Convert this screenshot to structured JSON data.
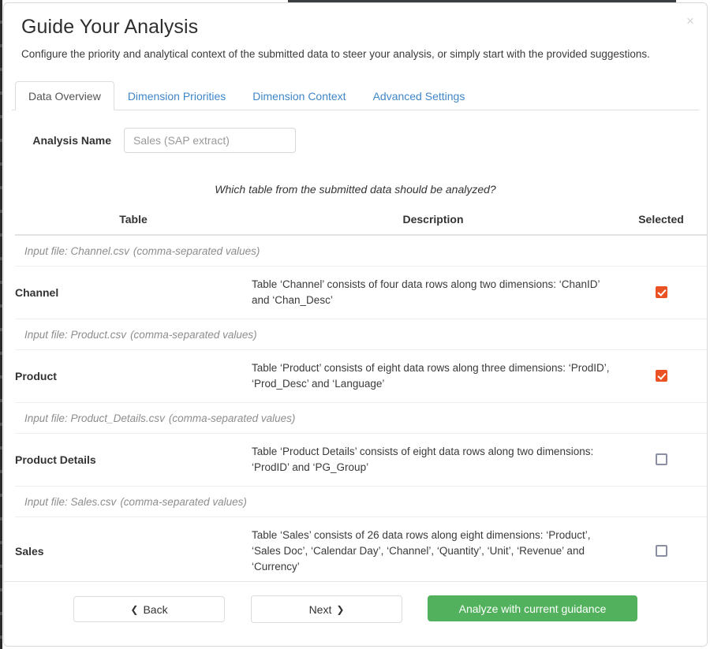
{
  "dialog": {
    "title": "Guide Your Analysis",
    "subtitle": "Configure the priority and analytical context of the submitted data to steer your analysis, or simply start with the provided suggestions.",
    "close_label": "×"
  },
  "tabs": [
    {
      "label": "Data Overview",
      "active": true
    },
    {
      "label": "Dimension Priorities",
      "active": false
    },
    {
      "label": "Dimension Context",
      "active": false
    },
    {
      "label": "Advanced Settings",
      "active": false
    }
  ],
  "form": {
    "analysis_name_label": "Analysis Name",
    "analysis_name_value": "",
    "analysis_name_placeholder": "Sales (SAP extract)"
  },
  "question": "Which table from the submitted data should be analyzed?",
  "table": {
    "headers": {
      "table": "Table",
      "description": "Description",
      "selected": "Selected"
    },
    "groups": [
      {
        "file_prefix": "Input file: Channel.csv",
        "file_format": "(comma-separated values)",
        "name": "Channel",
        "description": "Table ‘Channel’ consists of four data rows along two dimensions: ‘ChanID’ and ‘Chan_Desc’",
        "selected": true
      },
      {
        "file_prefix": "Input file: Product.csv",
        "file_format": "(comma-separated values)",
        "name": "Product",
        "description": "Table ‘Product’ consists of eight data rows along three dimensions: ‘ProdID’, ‘Prod_Desc’ and ‘Language’",
        "selected": true
      },
      {
        "file_prefix": "Input file: Product_Details.csv",
        "file_format": "(comma-separated values)",
        "name": "Product Details",
        "description": "Table ‘Product Details’ consists of eight data rows along two dimensions: ‘ProdID’ and ‘PG_Group’",
        "selected": false
      },
      {
        "file_prefix": "Input file: Sales.csv",
        "file_format": "(comma-separated values)",
        "name": "Sales",
        "description": "Table ‘Sales’ consists of 26 data rows along eight dimensions: ‘Product’, ‘Sales Doc’, ‘Calendar Day’, ‘Channel’, ‘Quantity’, ‘Unit’, ‘Revenue’ and ‘Currency’",
        "selected": false
      }
    ]
  },
  "footer": {
    "back_label": "Back",
    "back_icon": "❮",
    "next_label": "Next",
    "next_icon": "❯",
    "analyze_label": "Analyze with current guidance"
  },
  "colors": {
    "accent_checkbox": "#ea5224",
    "primary_action": "#51b15c",
    "tab_link": "#3f86c8"
  }
}
